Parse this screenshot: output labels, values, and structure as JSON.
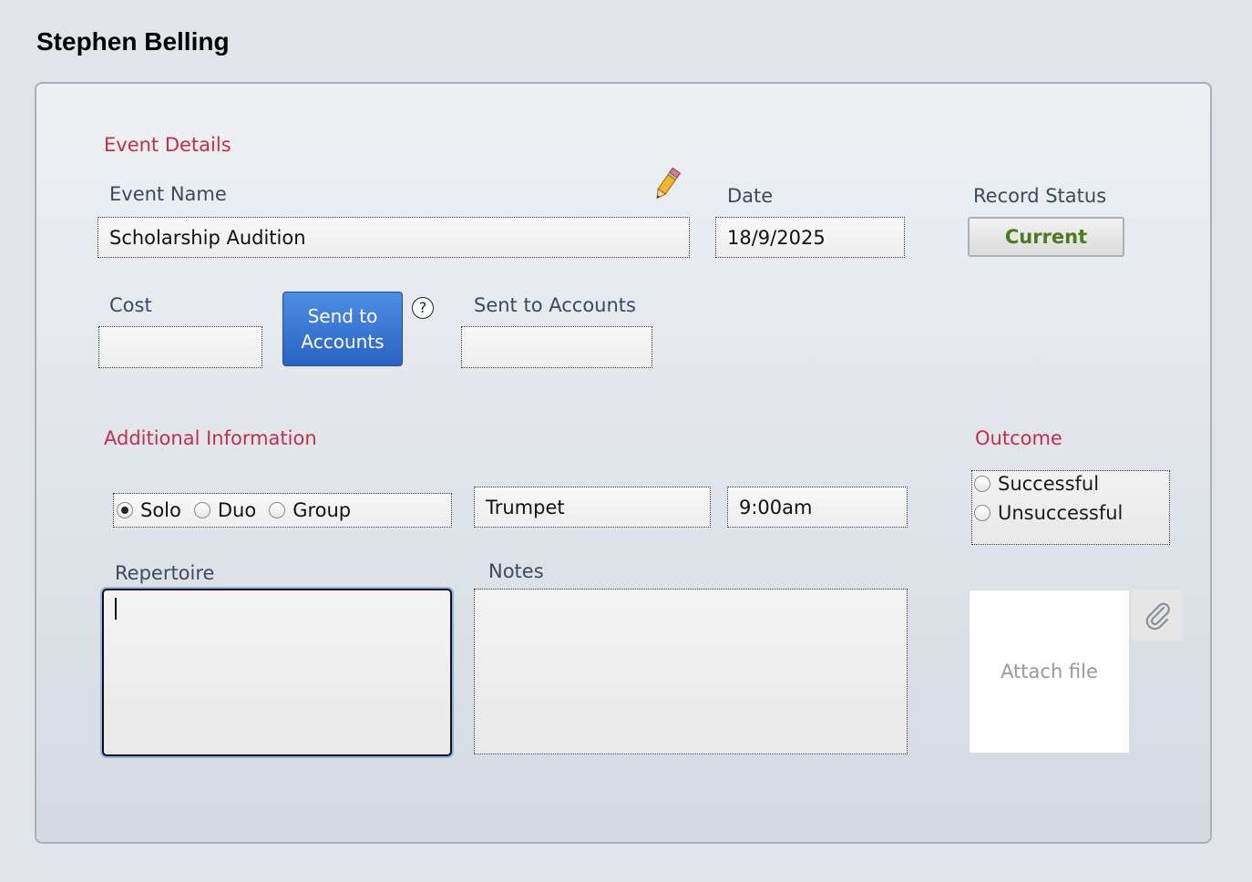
{
  "page": {
    "title": "Stephen Belling"
  },
  "event_details": {
    "section_label": "Event Details",
    "event_name_label": "Event Name",
    "event_name_value": "Scholarship Audition",
    "date_label": "Date",
    "date_value": "18/9/2025",
    "record_status_label": "Record Status",
    "record_status_value": "Current",
    "cost_label": "Cost",
    "cost_value": "",
    "send_button_line1": "Send to",
    "send_button_line2": "Accounts",
    "help_glyph": "?",
    "sent_label": "Sent to Accounts",
    "sent_value": ""
  },
  "additional": {
    "section_label": "Additional Information",
    "type_options": [
      {
        "label": "Solo",
        "selected": true
      },
      {
        "label": "Duo",
        "selected": false
      },
      {
        "label": "Group",
        "selected": false
      }
    ],
    "instrument_value": "Trumpet",
    "time_value": "9:00am",
    "repertoire_label": "Repertoire",
    "notes_label": "Notes"
  },
  "outcome": {
    "section_label": "Outcome",
    "options": [
      {
        "label": "Successful",
        "selected": false
      },
      {
        "label": "Unsuccessful",
        "selected": false
      }
    ]
  },
  "attachment": {
    "placeholder": "Attach file"
  },
  "icons": {
    "edit": "pencil-icon",
    "attach": "paperclip-icon"
  },
  "colors": {
    "section": "#c0304c",
    "status": "#4b7a1f",
    "button": "#2a63c2"
  }
}
